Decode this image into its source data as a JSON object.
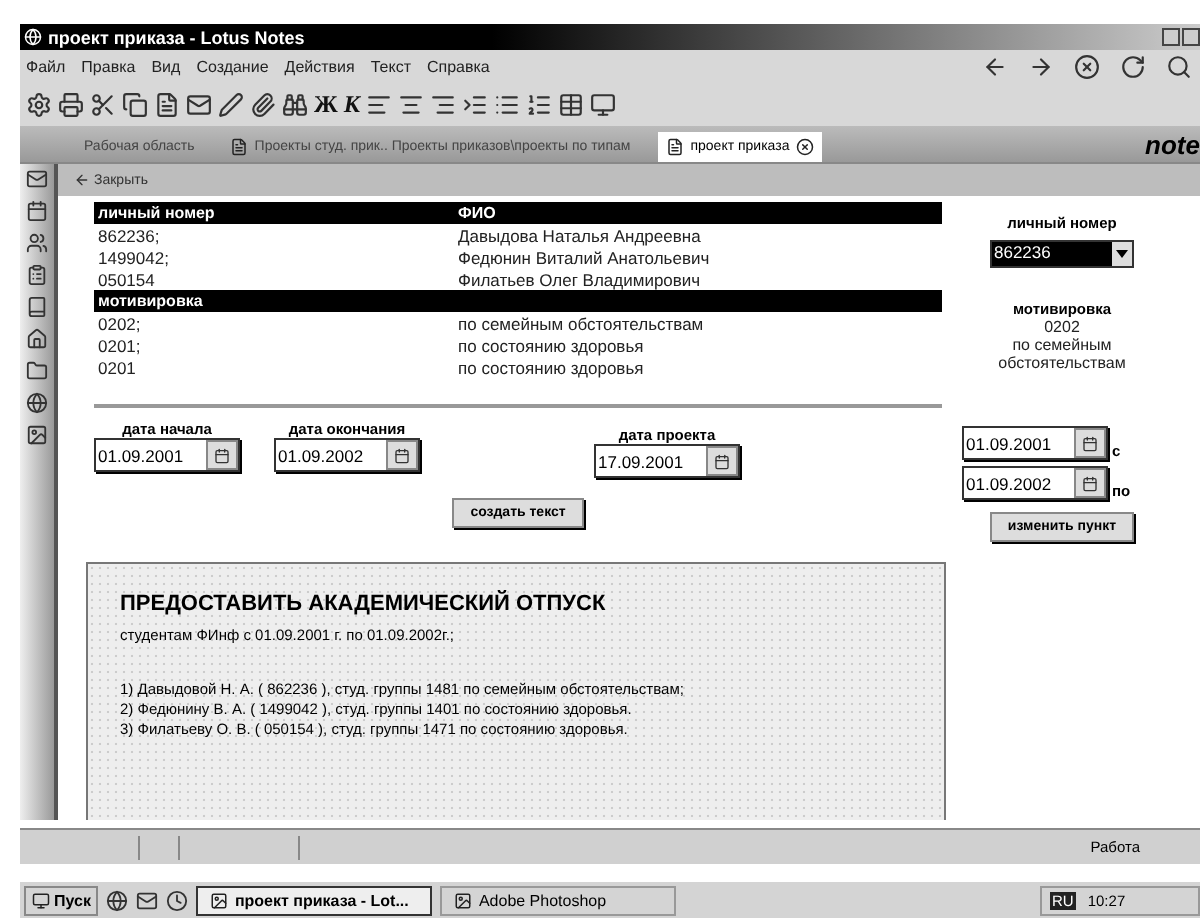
{
  "window": {
    "title": "проект приказа - Lotus Notes"
  },
  "menu": [
    "Файл",
    "Правка",
    "Вид",
    "Создание",
    "Действия",
    "Текст",
    "Справка"
  ],
  "format_buttons": [
    "Ж",
    "К"
  ],
  "tabs": [
    {
      "label": "Рабочая область",
      "selected": false
    },
    {
      "label": "Проекты студ. прик.. Проекты приказов\\проекты по типам",
      "selected": false
    },
    {
      "label": "проект приказа",
      "selected": true
    }
  ],
  "brand": "note",
  "action_bar": {
    "close": "Закрыть"
  },
  "students": {
    "columns": [
      "личный номер",
      "ФИО"
    ],
    "rows": [
      {
        "number": "862236;",
        "name": "Давыдова Наталья Андреевна"
      },
      {
        "number": "1499042;",
        "name": "Федюнин Виталий Анатольевич"
      },
      {
        "number": "050154",
        "name": "Филатьев Олег Владимирович"
      }
    ]
  },
  "motivation": {
    "heading": "мотивировка",
    "rows": [
      {
        "code": "0202;",
        "text": "по семейным обстоятельствам"
      },
      {
        "code": "0201;",
        "text": "по состоянию здоровья"
      },
      {
        "code": "0201",
        "text": "по состоянию здоровья"
      }
    ]
  },
  "right_panel": {
    "number_label": "личный номер",
    "number_value": "862236",
    "motivation_label": "мотивировка",
    "motivation_code": "0202",
    "motivation_text": [
      "по семейным",
      "обстоятельствам"
    ],
    "from_date": "01.09.2001",
    "from_label": "с",
    "to_date": "01.09.2002",
    "to_label": "по",
    "button": "изменить пункт"
  },
  "dates": [
    {
      "label": "дата начала",
      "value": "01.09.2001"
    },
    {
      "label": "дата окончания",
      "value": "01.09.2002"
    },
    {
      "label": "дата проекта",
      "value": "17.09.2001"
    }
  ],
  "create_button": "создать текст",
  "document": {
    "title": "ПРЕДОСТАВИТЬ АКАДЕМИЧЕСКИЙ ОТПУСК",
    "subtitle": "студентам  ФИнф с 01.09.2001 г. по 01.09.2002г.;",
    "items": [
      "1) Давыдовой Н. А. ( 862236 ), студ. группы 1481 по семейным обстоятельствам;",
      "2) Федюнину В. А. ( 1499042 ), студ. группы 1401 по состоянию здоровья.",
      "3) Филатьеву О. В. ( 050154 ), студ. группы 1471 по состоянию здоровья."
    ]
  },
  "status_bar": {
    "location": "Работа"
  },
  "taskbar": {
    "start": "Пуск",
    "tasks": [
      {
        "label": "проект приказа - Lot...",
        "selected": true
      },
      {
        "label": "Adobe Photoshop",
        "selected": false
      }
    ],
    "language": "RU",
    "time": "10:27"
  }
}
